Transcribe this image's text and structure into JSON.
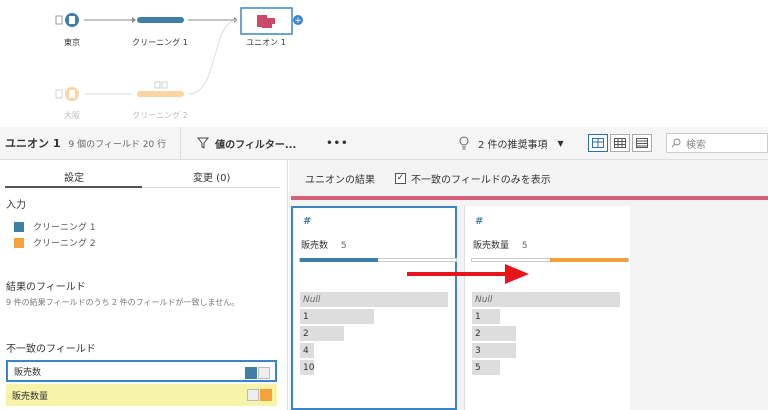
{
  "flow": {
    "nodes": [
      {
        "label": "東京"
      },
      {
        "label": "クリーニング 1"
      },
      {
        "label": "ユニオン 1"
      },
      {
        "label": "大阪"
      },
      {
        "label": "クリーニング 2"
      }
    ]
  },
  "toolbar": {
    "title": "ユニオン 1",
    "meta": "9 個のフィールド  20 行",
    "filter_label": "値のフィルター...",
    "more_label": "•••",
    "recommendations": "2 件の推奨事項",
    "search_placeholder": "検索"
  },
  "left": {
    "tab_settings": "設定",
    "tab_changes": "変更 (0)",
    "inputs_title": "入力",
    "inputs": [
      {
        "label": "クリーニング 1",
        "color": "#3f7fa6"
      },
      {
        "label": "クリーニング 2",
        "color": "#f5a13a"
      }
    ],
    "result_title": "結果のフィールド",
    "result_note": "9 件の結果フィールドのうち 2 件のフィールドが一致しません。",
    "mismatch_title": "不一致のフィールド",
    "mismatch": [
      {
        "label": "販売数"
      },
      {
        "label": "販売数量"
      }
    ]
  },
  "right": {
    "header_title": "ユニオンの結果",
    "checkbox_label": "不一致のフィールドのみを表示",
    "cards": [
      {
        "type_icon": "#",
        "name": "販売数",
        "count": "5",
        "values": [
          "Null",
          "1",
          "2",
          "4",
          "10"
        ]
      },
      {
        "type_icon": "#",
        "name": "販売数量",
        "count": "5",
        "values": [
          "Null",
          "1",
          "2",
          "3",
          "5"
        ]
      }
    ]
  },
  "colors": {
    "blue": "#3f7fa6",
    "orange": "#f5a13a",
    "union_accent": "#d4607a",
    "arrow": "#e8141c"
  }
}
